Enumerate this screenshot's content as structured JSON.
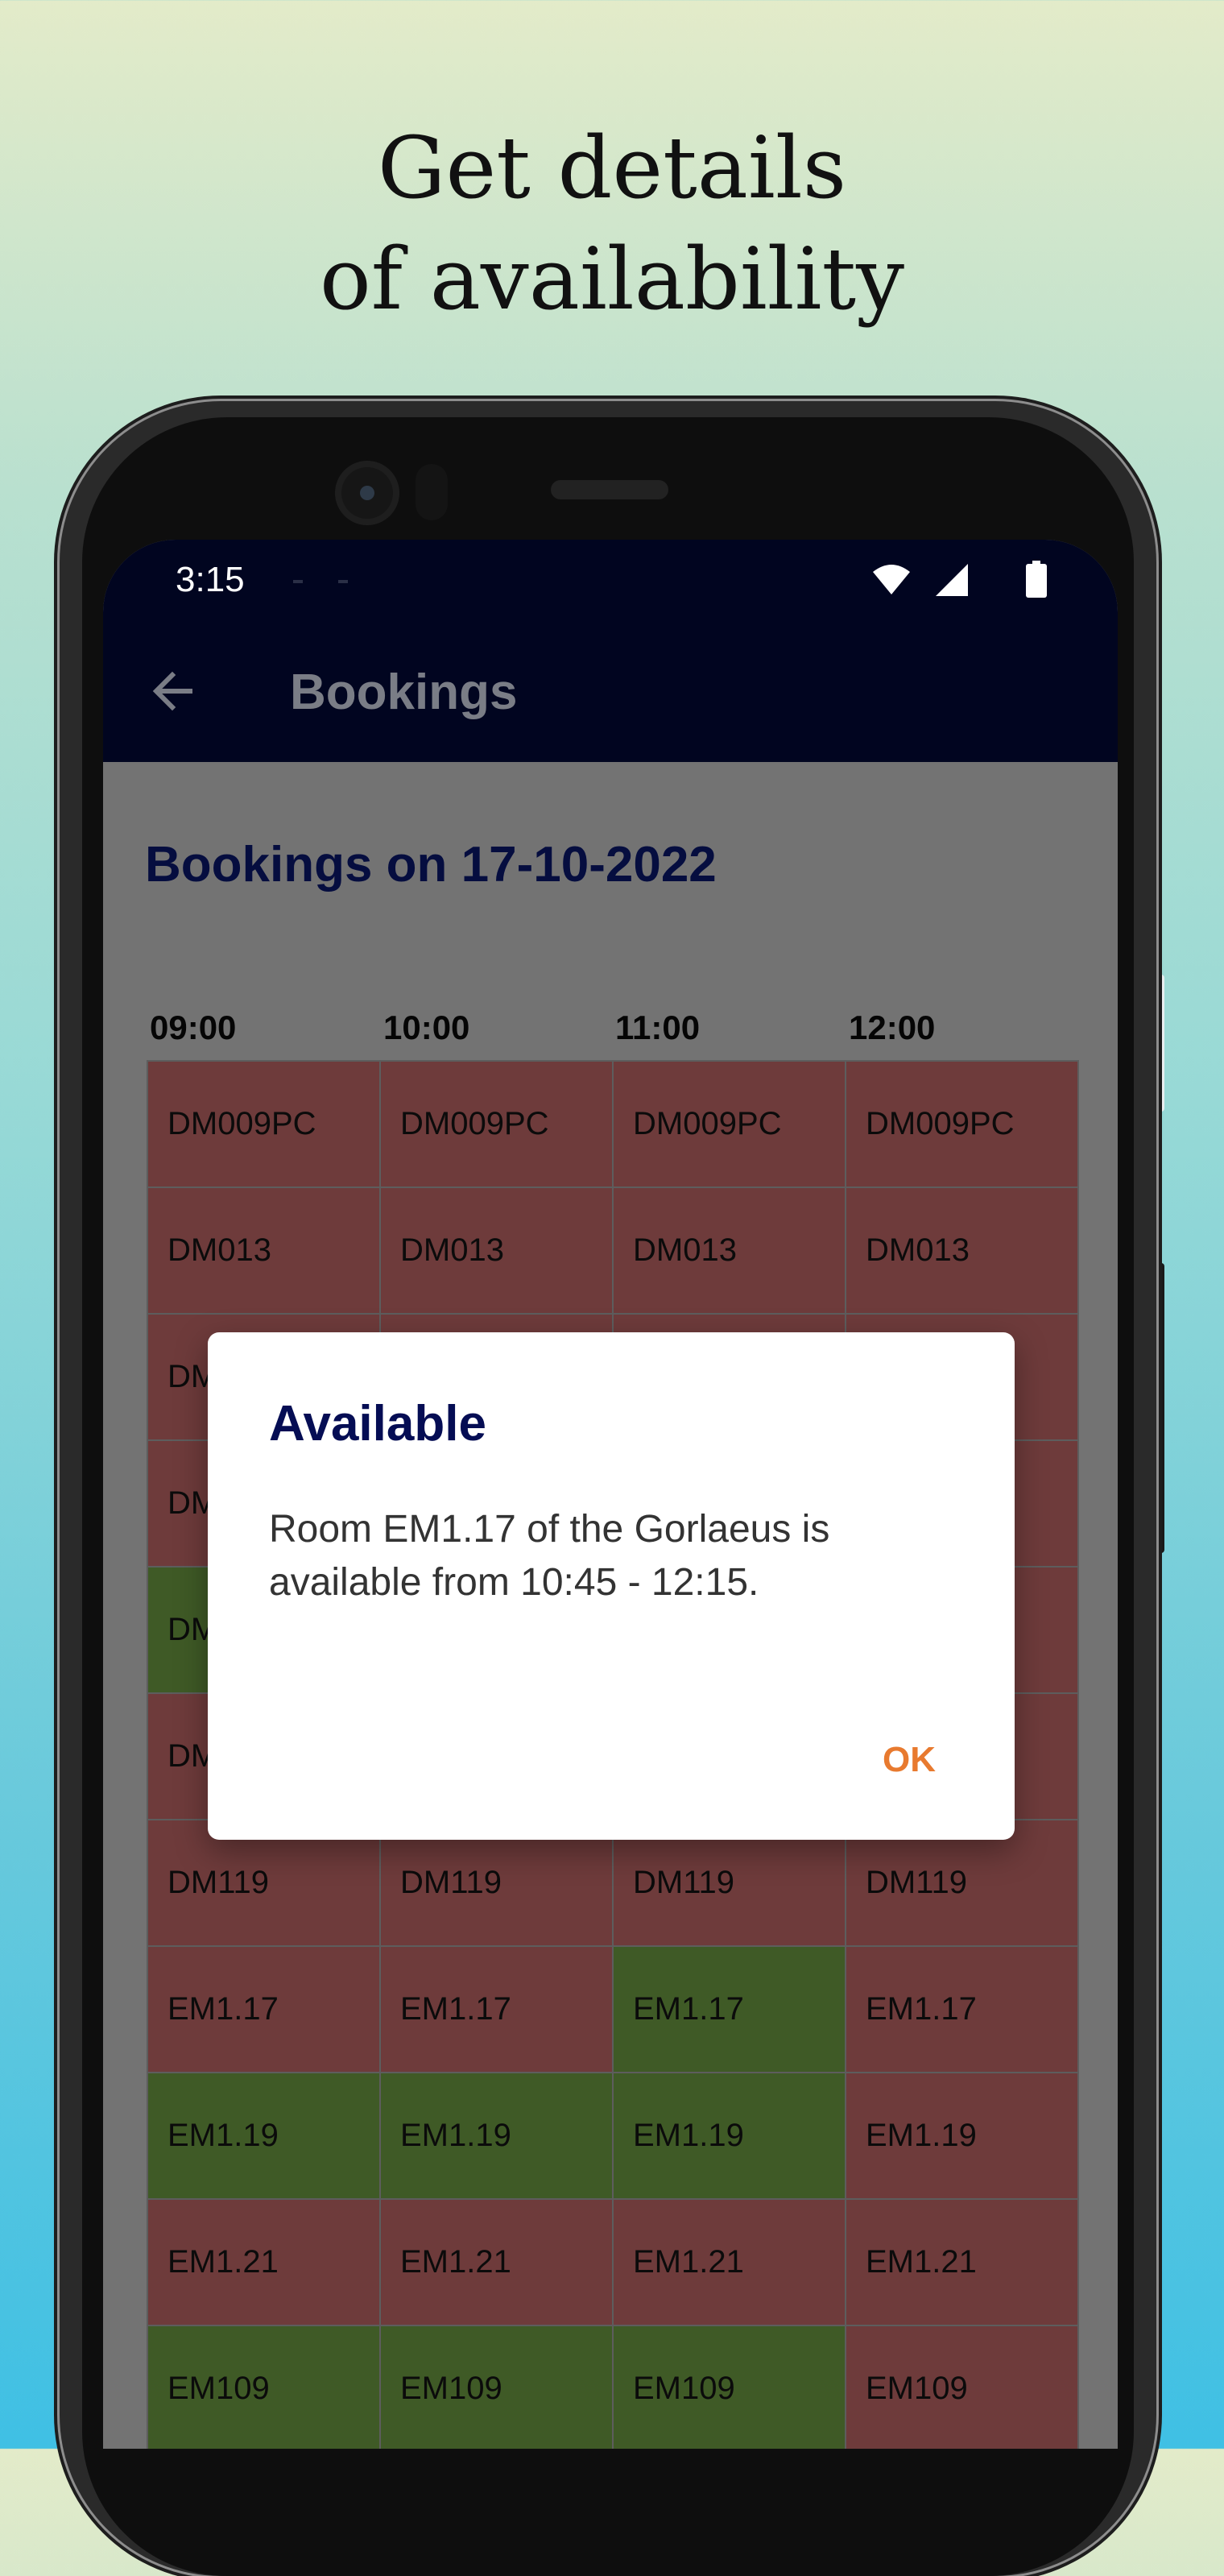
{
  "headline": {
    "line1": "Get details",
    "line2": "of availability"
  },
  "statusbar": {
    "time": "3:15",
    "icons": [
      "wifi-icon",
      "signal-icon",
      "battery-icon"
    ]
  },
  "appbar": {
    "back_icon": "back-arrow-icon",
    "title": "Bookings"
  },
  "page_title": "Bookings on 17-10-2022",
  "time_slots": [
    "09:00",
    "10:00",
    "11:00",
    "12:00"
  ],
  "colors": {
    "booked": "#6e3b3b",
    "available": "#3f5a26",
    "appbar": "#010520",
    "dialog_title": "#050d54",
    "ok_button": "#e87a2f"
  },
  "rooms": [
    {
      "name": "DM009PC",
      "status": [
        "booked",
        "booked",
        "booked",
        "booked"
      ]
    },
    {
      "name": "DM013",
      "status": [
        "booked",
        "booked",
        "booked",
        "booked"
      ]
    },
    {
      "name": "DM",
      "status": [
        "booked",
        "booked",
        "booked",
        "booked"
      ]
    },
    {
      "name": "DM",
      "status": [
        "booked",
        "booked",
        "booked",
        "booked"
      ]
    },
    {
      "name": "DM",
      "status": [
        "available",
        "booked",
        "booked",
        "booked"
      ]
    },
    {
      "name": "DM",
      "status": [
        "booked",
        "booked",
        "booked",
        "booked"
      ]
    },
    {
      "name": "DM119",
      "status": [
        "booked",
        "booked",
        "booked",
        "booked"
      ]
    },
    {
      "name": "EM1.17",
      "status": [
        "booked",
        "booked",
        "available",
        "booked"
      ]
    },
    {
      "name": "EM1.19",
      "status": [
        "available",
        "available",
        "available",
        "booked"
      ]
    },
    {
      "name": "EM1.21",
      "status": [
        "booked",
        "booked",
        "booked",
        "booked"
      ]
    },
    {
      "name": "EM109",
      "status": [
        "available",
        "available",
        "available",
        "booked"
      ]
    }
  ],
  "dialog": {
    "title": "Available",
    "message": "Room EM1.17 of the Gorlaeus is available from 10:45 - 12:15.",
    "ok_label": "OK"
  }
}
